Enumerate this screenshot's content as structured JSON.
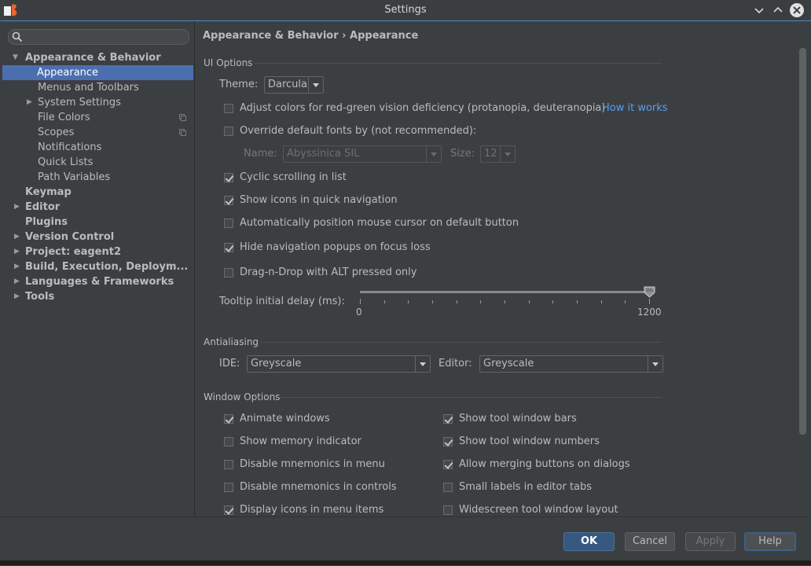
{
  "window": {
    "title": "Settings"
  },
  "sidebar": {
    "search_placeholder": "",
    "items": [
      {
        "label": "Appearance & Behavior",
        "bold": true,
        "expanded": true
      },
      {
        "label": "Appearance",
        "selected": true
      },
      {
        "label": "Menus and Toolbars"
      },
      {
        "label": "System Settings",
        "collapsed": true
      },
      {
        "label": "File Colors"
      },
      {
        "label": "Scopes"
      },
      {
        "label": "Notifications"
      },
      {
        "label": "Quick Lists"
      },
      {
        "label": "Path Variables"
      },
      {
        "label": "Keymap",
        "bold": true
      },
      {
        "label": "Editor",
        "bold": true
      },
      {
        "label": "Plugins",
        "bold": true
      },
      {
        "label": "Version Control",
        "bold": true
      },
      {
        "label": "Project: eagent2",
        "bold": true
      },
      {
        "label": "Build, Execution, Deploym...",
        "bold": true
      },
      {
        "label": "Languages & Frameworks",
        "bold": true
      },
      {
        "label": "Tools",
        "bold": true
      }
    ]
  },
  "breadcrumb": "Appearance & Behavior › Appearance",
  "ui_options": {
    "title": "UI Options",
    "theme_label": "Theme:",
    "theme_value": "Darcula",
    "adjust_colors": {
      "label": "Adjust colors for red-green vision deficiency (protanopia, deuteranopia)",
      "checked": false
    },
    "how_it_works": "How it works",
    "override_fonts": {
      "label": "Override default fonts by (not recommended):",
      "checked": false
    },
    "name_label": "Name:",
    "name_value": "Abyssinica SIL",
    "size_label": "Size:",
    "size_value": "12",
    "cyclic_scrolling": {
      "label": "Cyclic scrolling in list",
      "checked": true
    },
    "show_icons_quick_nav": {
      "label": "Show icons in quick navigation",
      "checked": true
    },
    "auto_position_cursor": {
      "label": "Automatically position mouse cursor on default button",
      "checked": false
    },
    "hide_nav_popups": {
      "label": "Hide navigation popups on focus loss",
      "checked": true
    },
    "drag_n_drop_alt": {
      "label": "Drag-n-Drop with ALT pressed only",
      "checked": false
    },
    "tooltip_delay_label": "Tooltip initial delay (ms):",
    "tooltip_min": "0",
    "tooltip_max": "1200",
    "tooltip_value": 1200
  },
  "antialiasing": {
    "title": "Antialiasing",
    "ide_label": "IDE:",
    "ide_value": "Greyscale",
    "editor_label": "Editor:",
    "editor_value": "Greyscale"
  },
  "window_options": {
    "title": "Window Options",
    "left": [
      {
        "label": "Animate windows",
        "checked": true
      },
      {
        "label": "Show memory indicator",
        "checked": false
      },
      {
        "label": "Disable mnemonics in menu",
        "checked": false
      },
      {
        "label": "Disable mnemonics in controls",
        "checked": false
      },
      {
        "label": "Display icons in menu items",
        "checked": true
      }
    ],
    "right": [
      {
        "label": "Show tool window bars",
        "checked": true
      },
      {
        "label": "Show tool window numbers",
        "checked": true
      },
      {
        "label": "Allow merging buttons on dialogs",
        "checked": true
      },
      {
        "label": "Small labels in editor tabs",
        "checked": false
      },
      {
        "label": "Widescreen tool window layout",
        "checked": false
      }
    ]
  },
  "footer": {
    "ok": "OK",
    "cancel": "Cancel",
    "apply": "Apply",
    "help": "Help"
  },
  "colors": {
    "accent": "#4b6eaf",
    "link": "#589df6",
    "background": "#3c3f41"
  }
}
